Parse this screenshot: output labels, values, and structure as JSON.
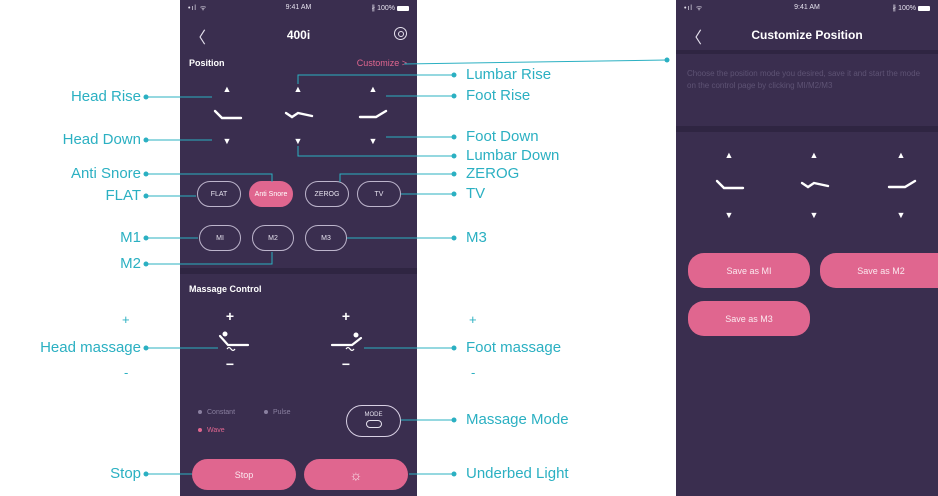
{
  "status": {
    "signal": "•ıl ᯤ",
    "time": "9:41 AM",
    "battery": "∦ 100%"
  },
  "main_screen": {
    "title": "400i",
    "position_label": "Position",
    "customize_link": "Customize >",
    "presets": [
      "FLAT",
      "Anti Snore",
      "ZEROG",
      "TV"
    ],
    "memories": [
      "MI",
      "M2",
      "M3"
    ],
    "massage_label": "Massage Control",
    "modes": [
      "Constant",
      "Pulse",
      "Wave"
    ],
    "selected_mode": "Wave",
    "mode_button": "MODE",
    "stop_button": "Stop",
    "light_icon": "☼"
  },
  "custom_screen": {
    "title": "Customize Position",
    "description": "Choose the position mode you desired, save it and start the mode on the control page by clicking MI/M2/M3",
    "save_m1": "Save as MI",
    "save_m2": "Save as M2",
    "save_m3": "Save as M3"
  },
  "callouts": {
    "head_rise": "Head Rise",
    "head_down": "Head Down",
    "anti_snore": "Anti Snore",
    "flat": "FLAT",
    "m1": "M1",
    "m2": "M2",
    "head_massage": "Head massage",
    "stop": "Stop",
    "lumbar_rise": "Lumbar Rise",
    "foot_rise": "Foot Rise",
    "foot_down": "Foot Down",
    "lumbar_down": "Lumbar Down",
    "zerog": "ZEROG",
    "tv": "TV",
    "m3": "M3",
    "foot_massage": "Foot massage",
    "massage_mode": "Massage Mode",
    "underbed_light": "Underbed Light",
    "plus": "+",
    "minus": "-"
  },
  "colors": {
    "phone_bg": "#3a2e4f",
    "accent": "#e0668f",
    "callout": "#2bb0c2"
  }
}
